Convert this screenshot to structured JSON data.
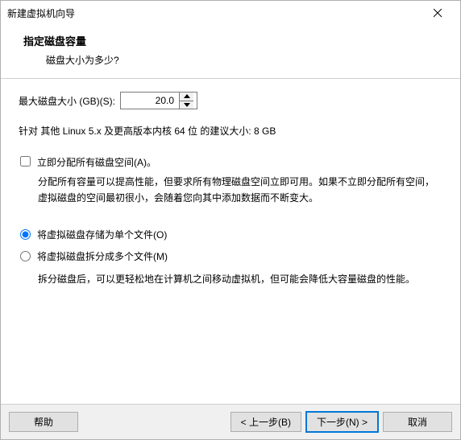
{
  "title": "新建虚拟机向导",
  "header": {
    "title": "指定磁盘容量",
    "subtitle": "磁盘大小为多少?"
  },
  "disk": {
    "size_label": "最大磁盘大小 (GB)(S):",
    "size_value": "20.0",
    "recommendation": "针对 其他 Linux 5.x 及更高版本内核 64 位 的建议大小: 8 GB"
  },
  "allocate": {
    "label": "立即分配所有磁盘空间(A)。",
    "desc": "分配所有容量可以提高性能，但要求所有物理磁盘空间立即可用。如果不立即分配所有空间，虚拟磁盘的空间最初很小，会随着您向其中添加数据而不断变大。"
  },
  "store": {
    "single_label": "将虚拟磁盘存储为单个文件(O)",
    "split_label": "将虚拟磁盘拆分成多个文件(M)",
    "split_desc": "拆分磁盘后，可以更轻松地在计算机之间移动虚拟机，但可能会降低大容量磁盘的性能。"
  },
  "buttons": {
    "help": "帮助",
    "back": "< 上一步(B)",
    "next": "下一步(N) >",
    "cancel": "取消"
  }
}
